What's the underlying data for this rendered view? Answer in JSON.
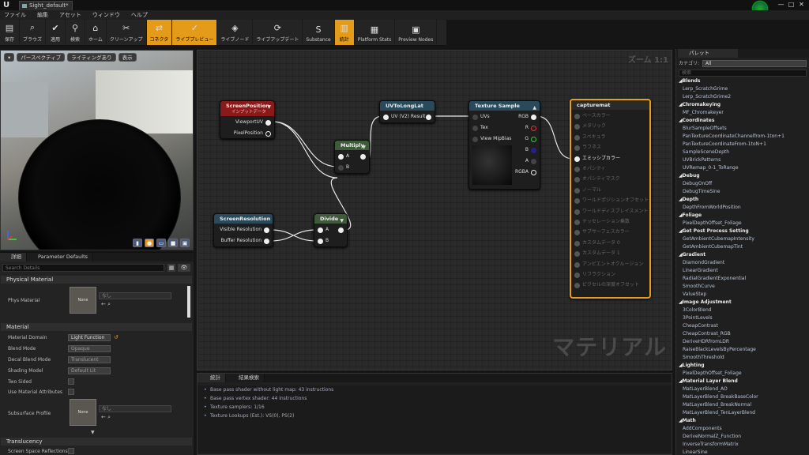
{
  "window": {
    "tab": "Sight_default*",
    "min": "—",
    "max": "□",
    "close": "✕"
  },
  "menu": [
    "ファイル",
    "編集",
    "アセット",
    "ウィンドウ",
    "ヘルプ"
  ],
  "toolbar": [
    {
      "label": "保存",
      "icon": "save-icon",
      "active": false
    },
    {
      "label": "ブラウズ",
      "icon": "browse-icon",
      "active": false
    },
    {
      "label": "適用",
      "icon": "apply-icon",
      "active": false
    },
    {
      "label": "検索",
      "icon": "search-icon",
      "active": false
    },
    {
      "label": "ホーム",
      "icon": "home-icon",
      "active": false
    },
    {
      "label": "クリーンアップ",
      "icon": "cleanup-icon",
      "active": false
    },
    {
      "label": "コネクタ",
      "icon": "connector-icon",
      "active": true
    },
    {
      "label": "ライブプレビュー",
      "icon": "live-preview-icon",
      "active": true
    },
    {
      "label": "ライブノード",
      "icon": "live-nodes-icon",
      "active": false
    },
    {
      "label": "ライブアップデート",
      "icon": "live-update-icon",
      "active": false
    },
    {
      "label": "Substance",
      "icon": "substance-icon",
      "active": false
    },
    {
      "label": "統計",
      "icon": "stats-icon",
      "active": true
    },
    {
      "label": "Platform Stats",
      "icon": "platform-stats-icon",
      "active": false
    },
    {
      "label": "Preview Nodes",
      "icon": "preview-nodes-icon",
      "active": false
    }
  ],
  "viewport": {
    "perspective": "パースペクティブ",
    "lighting": "ライティングあり",
    "show": "表示"
  },
  "details": {
    "tab1": "詳細",
    "tab2": "Parameter Defaults",
    "search_placeholder": "Search Details",
    "physical_material": "Physical Material",
    "phys_material": "Phys Material",
    "none_label": "None",
    "none_value": "なし",
    "material": "Material",
    "material_domain": "Material Domain",
    "material_domain_value": "Light Function",
    "blend_mode": "Blend Mode",
    "blend_mode_value": "Opaque",
    "decal_blend_mode": "Decal Blend Mode",
    "decal_blend_mode_value": "Translucent",
    "shading_model": "Shading Model",
    "shading_model_value": "Default Lit",
    "two_sided": "Two Sided",
    "use_material_attributes": "Use Material Attributes",
    "subsurface_profile": "Subsurface Profile",
    "translucency": "Translucency",
    "screen_space_reflections": "Screen Space Reflections"
  },
  "graph": {
    "zoom": "ズーム 1:1",
    "watermark": "マテリアル",
    "screenposition": {
      "title": "ScreenPosition",
      "subtitle": "インプットデータ",
      "pins": [
        "ViewportUV",
        "PixelPosition"
      ]
    },
    "uvtolonglat": {
      "title": "UVToLongLat",
      "pins": [
        "UV (V2) Result"
      ]
    },
    "texturesample": {
      "title": "Texture Sample",
      "inputs": [
        "UVs",
        "Tex",
        "View MipBias"
      ],
      "outputs": [
        "RGB",
        "R",
        "G",
        "B",
        "A",
        "RGBA"
      ]
    },
    "multiply": {
      "title": "Multiply",
      "pins": [
        "A",
        "B"
      ]
    },
    "screenresolution": {
      "title": "ScreenResolution",
      "pins": [
        "Visible Resolution",
        "Buffer Resolution"
      ]
    },
    "divide": {
      "title": "Divide",
      "pins": [
        "A",
        "B"
      ]
    },
    "capturemat": {
      "title": "capturemat",
      "pins": [
        "ベースカラー",
        "メタリック",
        "スペキュラ",
        "ラフネス",
        "エミッシブカラー",
        "オパシティ",
        "オパシティマスク",
        "ノーマル",
        "ワールドポジションオフセット",
        "ワールドディスプレイスメント",
        "テッセレーション乗数",
        "サブサーフェスカラー",
        "カスタムデータ 0",
        "カスタムデータ 1",
        "アンビエントオクルージョン",
        "リフラクション",
        "ピクセルの深度オフセット"
      ]
    }
  },
  "bottom": {
    "tab1": "統計",
    "tab2": "結果検索",
    "lines": [
      "Base pass shader without light map: 43 instructions",
      "Base pass vertex shader: 44 instructions",
      "Texture samplers: 1/16",
      "Texture Lookups (Est.): VS(0), PS(2)"
    ]
  },
  "palette": {
    "tab": "パレット",
    "category_label": "カテゴリ:",
    "category_value": "All",
    "search_placeholder": "検索",
    "groups": [
      {
        "name": "Blends",
        "items": [
          "Lerp_ScratchGrime",
          "Lerp_ScratchGrime2"
        ]
      },
      {
        "name": "Chromakeying",
        "items": [
          "MF_Chromakeyer"
        ]
      },
      {
        "name": "Coordinates",
        "items": [
          "BlurSampleOffsets",
          "PanTextureCoordinateChannelfrom-1ton+1",
          "PanTextureCoordinateFrom-1toN+1",
          "SampleSceneDepth",
          "UVBrickPatterns",
          "UVRemap_0-1_ToRange"
        ]
      },
      {
        "name": "Debug",
        "items": [
          "DebugOnOff",
          "DebugTimeSine"
        ]
      },
      {
        "name": "Depth",
        "items": [
          "DepthFromWorldPosition"
        ]
      },
      {
        "name": "Foliage",
        "items": [
          "PixelDepthOffset_Foliage"
        ]
      },
      {
        "name": "Get Post Process Setting",
        "items": [
          "GetAmbientCubemapIntensity",
          "GetAmbientCubemapTint"
        ]
      },
      {
        "name": "Gradient",
        "items": [
          "DiamondGradient",
          "LinearGradient",
          "RadialGradientExponential",
          "SmoothCurve",
          "ValueStep"
        ]
      },
      {
        "name": "Image Adjustment",
        "items": [
          "3ColorBlend",
          "3PointLevels",
          "CheapContrast",
          "CheapContrast_RGB",
          "DeriveHDRfromLDR",
          "RaiseBlackLevelsByPercentage",
          "SmoothThreshold"
        ]
      },
      {
        "name": "Lighting",
        "items": [
          "PixelDepthOffset_Foliage"
        ]
      },
      {
        "name": "Material Layer Blend",
        "items": [
          "MatLayerBlend_AO",
          "MatLayerBlend_BreakBaseColor",
          "MatLayerBlend_BreakNormal",
          "MatLayerBlend_TenLayerBlend"
        ]
      },
      {
        "name": "Math",
        "items": [
          "AddComponents",
          "DeriveNormalZ_Function",
          "InverseTransformMatrix",
          "LinearSine"
        ]
      }
    ]
  }
}
